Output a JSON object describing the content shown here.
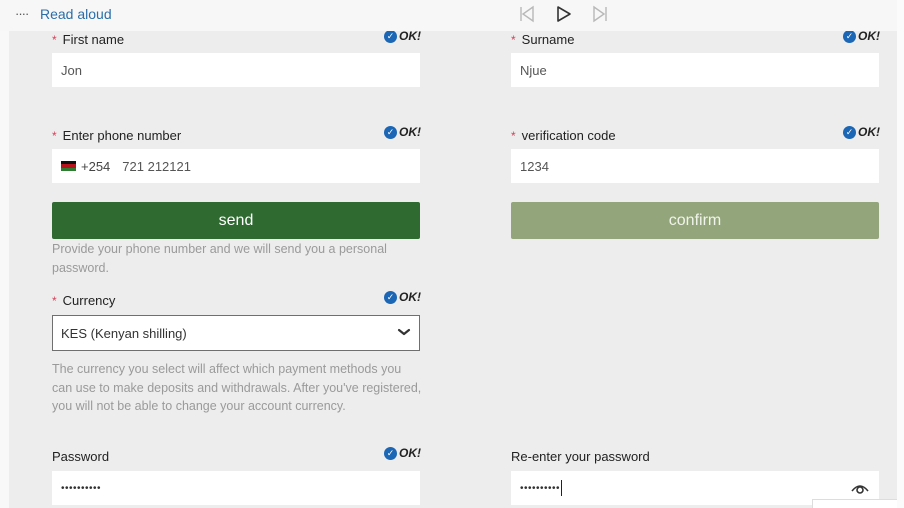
{
  "toolbar": {
    "more_icon": "ellipsis-icon",
    "read_aloud_label": "Read aloud",
    "controls": [
      "previous-icon",
      "play-icon",
      "next-icon"
    ]
  },
  "form": {
    "ok_text": "OK!",
    "required_marker": "*",
    "first_name": {
      "label": "First name",
      "value": "Jon",
      "required": true,
      "valid": true
    },
    "surname": {
      "label": "Surname",
      "value": "Njue",
      "required": true,
      "valid": true
    },
    "phone": {
      "label": "Enter phone number",
      "flag": "kenya-flag-icon",
      "dial_code": "+254",
      "value": "721 212121",
      "required": true,
      "valid": true
    },
    "verification": {
      "label": "verification code",
      "value": "1234",
      "required": true,
      "valid": true
    },
    "send_button": "send",
    "confirm_button": "confirm",
    "phone_help": "Provide your phone number and we will send you a personal password.",
    "currency": {
      "label": "Currency",
      "selected": "KES (Kenyan shilling)",
      "required": true,
      "valid": true,
      "help": "The currency you select will affect which payment methods you can use to make deposits and withdrawals. After you've registered, you will not be able to change your account currency."
    },
    "password": {
      "label": "Password",
      "masked_value": "••••••••••",
      "valid": true
    },
    "password_confirm": {
      "label": "Re-enter your password",
      "masked_value": "••••••••••",
      "toggle_icon": "eye-icon"
    }
  },
  "colors": {
    "send": "#2f6a31",
    "confirm": "#93a57b",
    "check": "#1b66b5",
    "required": "#d6405a",
    "link": "#2b6ea8"
  }
}
